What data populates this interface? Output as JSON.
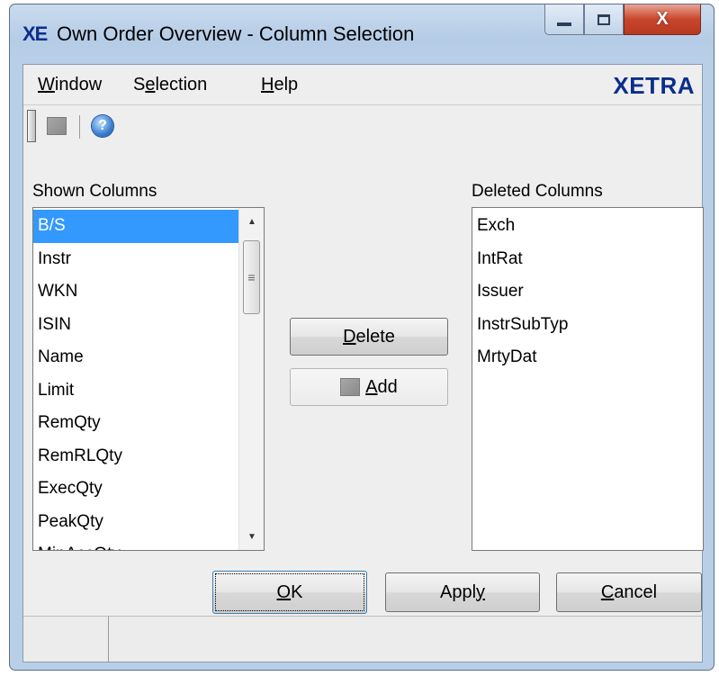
{
  "window": {
    "logo": "XE",
    "title": "Own Order Overview - Column Selection",
    "close_glyph": "X"
  },
  "menu": {
    "items": [
      {
        "label": "Window",
        "mnemonic": "W"
      },
      {
        "label": "Selection",
        "mnemonic": "e"
      },
      {
        "label": "Help",
        "mnemonic": "H"
      }
    ],
    "brand": "XETRA"
  },
  "toolbar": {
    "icons": [
      "grip-handle",
      "gray-square-icon",
      "help-icon"
    ],
    "help_glyph": "?"
  },
  "shown_columns": {
    "label": "Shown Columns",
    "items": [
      "B/S",
      "Instr",
      "WKN",
      "ISIN",
      "Name",
      "Limit",
      "RemQty",
      "RemRLQty",
      "ExecQty",
      "PeakQty",
      "MinAccQty"
    ],
    "selected_index": 0
  },
  "deleted_columns": {
    "label": "Deleted Columns",
    "items": [
      "Exch",
      "IntRat",
      "Issuer",
      "InstrSubTyp",
      "MrtyDat"
    ]
  },
  "buttons": {
    "delete": {
      "pre": "",
      "mnemonic": "D",
      "post": "elete"
    },
    "add": {
      "pre": "",
      "mnemonic": "A",
      "post": "dd"
    },
    "ok": {
      "pre": "",
      "mnemonic": "O",
      "post": "K"
    },
    "apply": {
      "pre": "Appl",
      "mnemonic": "y",
      "post": ""
    },
    "cancel": {
      "pre": "",
      "mnemonic": "C",
      "post": "ancel"
    }
  },
  "colors": {
    "brand": "#0b2e8c",
    "selection": "#3399ff",
    "close_button": "#c9452b"
  }
}
